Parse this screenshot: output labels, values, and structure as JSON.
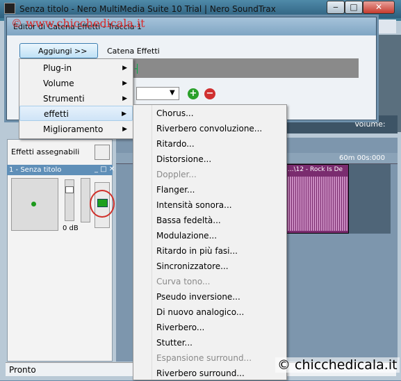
{
  "window": {
    "title": "Senza titolo - Nero MultiMedia Suite 10 Trial | Nero SoundTrax",
    "buttons": {
      "minimize": "‒",
      "maximize": "□",
      "close": "✕"
    }
  },
  "watermark_top": "© www.chicchedicala.it",
  "watermark_bottom": "© chicchedicala.it",
  "dialog": {
    "title": "Editor di Catena Effetti - Traccia 1",
    "add_button": "Aggiungi >>",
    "chain_label": "Catena Effetti"
  },
  "menu": {
    "items": [
      {
        "label": "Plug-in"
      },
      {
        "label": "Volume"
      },
      {
        "label": "Strumenti"
      },
      {
        "label": "effetti"
      },
      {
        "label": "Miglioramento"
      }
    ]
  },
  "submenu": {
    "items": [
      {
        "label": "Chorus...",
        "enabled": true
      },
      {
        "label": "Riverbero convoluzione...",
        "enabled": true
      },
      {
        "label": "Ritardo...",
        "enabled": true
      },
      {
        "label": "Distorsione...",
        "enabled": true
      },
      {
        "label": "Doppler...",
        "enabled": false
      },
      {
        "label": "Flanger...",
        "enabled": true
      },
      {
        "label": "Intensità sonora...",
        "enabled": true
      },
      {
        "label": "Bassa fedeltà...",
        "enabled": true
      },
      {
        "label": "Modulazione...",
        "enabled": true
      },
      {
        "label": "Ritardo in più fasi...",
        "enabled": true
      },
      {
        "label": "Sincronizzatore...",
        "enabled": true
      },
      {
        "label": "Curva tono...",
        "enabled": false
      },
      {
        "label": "Pseudo inversione...",
        "enabled": true
      },
      {
        "label": "Di nuovo analogico...",
        "enabled": true
      },
      {
        "label": "Riverbero...",
        "enabled": true
      },
      {
        "label": "Stutter...",
        "enabled": true
      },
      {
        "label": "Espansione surround...",
        "enabled": false
      },
      {
        "label": "Riverbero surround...",
        "enabled": true
      }
    ]
  },
  "left_panel": {
    "effects_assigned": "Effetti assegnabili",
    "track_name": "1 - Senza titolo",
    "track_controls": "_ □ ✕",
    "db": "0 dB"
  },
  "timeline": {
    "ruler_label": "60m 00s:000",
    "clip_title": "...\\12 - Rock Is De",
    "volume_label": "Volume:"
  },
  "status": "Pronto",
  "colors": {
    "highlight_circle": "#d0302a",
    "clip": "#7a2c6f"
  }
}
